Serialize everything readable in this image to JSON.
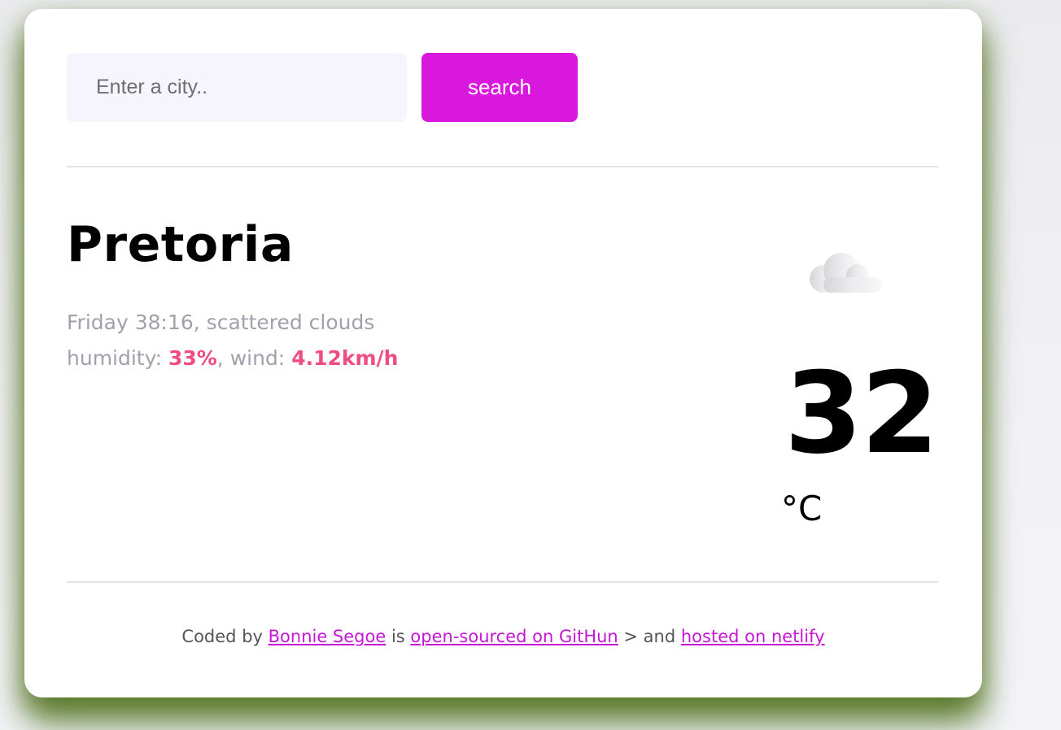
{
  "search": {
    "placeholder": "Enter a city..",
    "button_label": "search"
  },
  "weather": {
    "city": "Pretoria",
    "datetime": "Friday 38:16",
    "description": "scattered clouds",
    "humidity_label": "humidity: ",
    "humidity_value": "33%",
    "wind_label": "wind: ",
    "wind_value": "4.12km/h",
    "temperature": "32",
    "unit": "°C",
    "icon": "cloud-icon"
  },
  "footer": {
    "coded_by": "Coded by ",
    "author": "Bonnie Segoe",
    "is_text": " is ",
    "repo_link": "open-sourced on GitHun",
    "and_text": " > and ",
    "host_link": "hosted on netlify"
  },
  "colors": {
    "accent": "#d818dc",
    "value_highlight": "#ef4d7f",
    "link": "#c516d5",
    "muted_text": "#a39fab"
  }
}
